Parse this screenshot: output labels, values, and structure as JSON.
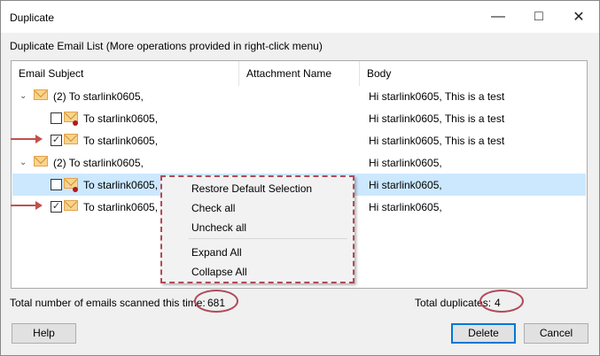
{
  "window": {
    "title": "Duplicate"
  },
  "caption": "Duplicate Email List (More operations provided in right-click menu)",
  "columns": [
    "Email Subject",
    "Attachment Name",
    "Body"
  ],
  "rows": [
    {
      "type": "group",
      "subject": "(2) To starlink0605,",
      "body": "Hi starlink0605, This is a test"
    },
    {
      "type": "item",
      "checked": false,
      "unread": true,
      "subject": "To starlink0605,",
      "body": "Hi starlink0605, This is a test"
    },
    {
      "type": "item",
      "checked": true,
      "unread": false,
      "arrow": true,
      "subject": "To starlink0605,",
      "body": "Hi starlink0605, This is a test"
    },
    {
      "type": "group",
      "subject": "(2) To starlink0605,",
      "body": "Hi starlink0605,"
    },
    {
      "type": "item",
      "checked": false,
      "unread": true,
      "selected": true,
      "subject": "To starlink0605,",
      "body": "Hi starlink0605,"
    },
    {
      "type": "item",
      "checked": true,
      "unread": false,
      "arrow": true,
      "subject": "To starlink0605,",
      "body": "Hi starlink0605,"
    }
  ],
  "context_menu": [
    "Restore Default Selection",
    "Check all",
    "Uncheck all",
    "Expand All",
    "Collapse All"
  ],
  "status": {
    "scanned_label": "Total number of emails scanned this time:",
    "scanned": "681",
    "dup_label": "Total duplicates:",
    "dup": "4"
  },
  "buttons": {
    "help": "Help",
    "delete": "Delete",
    "cancel": "Cancel"
  }
}
